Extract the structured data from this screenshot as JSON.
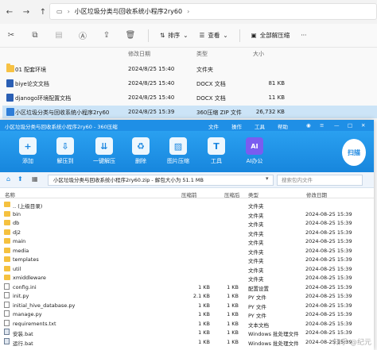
{
  "explorer": {
    "path_label": "小区垃圾分类与回收系统小程序2ry60",
    "toolbar": {
      "sort": "排序",
      "view": "查看",
      "select_all": "全部解压缩",
      "more": "···"
    },
    "columns": {
      "date": "修改日期",
      "type": "类型",
      "size": "大小"
    },
    "rows": [
      {
        "name": "01 配套环境",
        "date": "2024/8/25 15:40",
        "type": "文件夹",
        "size": "",
        "icon": "folder"
      },
      {
        "name": "biye论文文档",
        "date": "2024/8/25 15:40",
        "type": "DOCX 文档",
        "size": "81 KB",
        "icon": "docx"
      },
      {
        "name": "djanogo环境配置文档",
        "date": "2024/8/25 15:40",
        "type": "DOCX 文档",
        "size": "11 KB",
        "icon": "docx"
      },
      {
        "name": "小区垃圾分类与回收系统小程序2ry60",
        "date": "2024/8/25 15:39",
        "type": "360压缩 ZIP 文件",
        "size": "26,732 KB",
        "icon": "zip"
      }
    ]
  },
  "zip": {
    "title": "小区垃圾分类与回收系统小程序2ry60 - 360压缩",
    "menu": [
      "文件",
      "操作",
      "工具",
      "帮助"
    ],
    "tools": [
      {
        "label": "添加",
        "icon": "add-icon"
      },
      {
        "label": "解压到",
        "icon": "extract-icon"
      },
      {
        "label": "一键解压",
        "icon": "one-click-extract-icon"
      },
      {
        "label": "删除",
        "icon": "delete-icon"
      },
      {
        "label": "图片压缩",
        "icon": "image-compress-icon"
      },
      {
        "label": "工具",
        "icon": "tools-icon"
      },
      {
        "label": "AI办公",
        "icon": "ai-icon"
      }
    ],
    "scan_label": "扫描",
    "path_text": "小区垃圾分类与回收系统小程序2ry60.zip - 解包大小为 51.1 MB",
    "search_placeholder": "搜索包内文件",
    "columns": {
      "name": "名称",
      "compressed": "压缩前",
      "after": "压缩后",
      "type": "类型",
      "modified": "修改日期"
    },
    "rows": [
      {
        "name": ".. (上级目录)",
        "compressed": "",
        "after": "",
        "type": "文件夹",
        "modified": "",
        "icon": "folder"
      },
      {
        "name": "bin",
        "compressed": "",
        "after": "",
        "type": "文件夹",
        "modified": "2024-08-25 15:39",
        "icon": "folder"
      },
      {
        "name": "db",
        "compressed": "",
        "after": "",
        "type": "文件夹",
        "modified": "2024-08-25 15:39",
        "icon": "folder"
      },
      {
        "name": "dj2",
        "compressed": "",
        "after": "",
        "type": "文件夹",
        "modified": "2024-08-25 15:39",
        "icon": "folder"
      },
      {
        "name": "main",
        "compressed": "",
        "after": "",
        "type": "文件夹",
        "modified": "2024-08-25 15:39",
        "icon": "folder"
      },
      {
        "name": "media",
        "compressed": "",
        "after": "",
        "type": "文件夹",
        "modified": "2024-08-25 15:39",
        "icon": "folder"
      },
      {
        "name": "templates",
        "compressed": "",
        "after": "",
        "type": "文件夹",
        "modified": "2024-08-25 15:39",
        "icon": "folder"
      },
      {
        "name": "util",
        "compressed": "",
        "after": "",
        "type": "文件夹",
        "modified": "2024-08-25 15:39",
        "icon": "folder"
      },
      {
        "name": "xmiddleware",
        "compressed": "",
        "after": "",
        "type": "文件夹",
        "modified": "2024-08-25 15:39",
        "icon": "folder"
      },
      {
        "name": "config.ini",
        "compressed": "1 KB",
        "after": "1 KB",
        "type": "配置设置",
        "modified": "2024-08-25 15:39",
        "icon": "file"
      },
      {
        "name": "init.py",
        "compressed": "2.1 KB",
        "after": "1 KB",
        "type": "PY 文件",
        "modified": "2024-08-25 15:39",
        "icon": "file"
      },
      {
        "name": "initial_hive_database.py",
        "compressed": "1 KB",
        "after": "1 KB",
        "type": "PY 文件",
        "modified": "2024-08-25 15:39",
        "icon": "file"
      },
      {
        "name": "manage.py",
        "compressed": "1 KB",
        "after": "1 KB",
        "type": "PY 文件",
        "modified": "2024-08-25 15:39",
        "icon": "file"
      },
      {
        "name": "requirements.txt",
        "compressed": "1 KB",
        "after": "1 KB",
        "type": "文本文档",
        "modified": "2024-08-25 15:39",
        "icon": "file"
      },
      {
        "name": "安装.bat",
        "compressed": "1 KB",
        "after": "1 KB",
        "type": "Windows 批处理文件",
        "modified": "2024-08-25 15:39",
        "icon": "bat"
      },
      {
        "name": "运行.bat",
        "compressed": "1 KB",
        "after": "1 KB",
        "type": "Windows 批处理文件",
        "modified": "2024-08-25 15:39",
        "icon": "bat"
      }
    ]
  },
  "watermark": "知乎 @纪元"
}
